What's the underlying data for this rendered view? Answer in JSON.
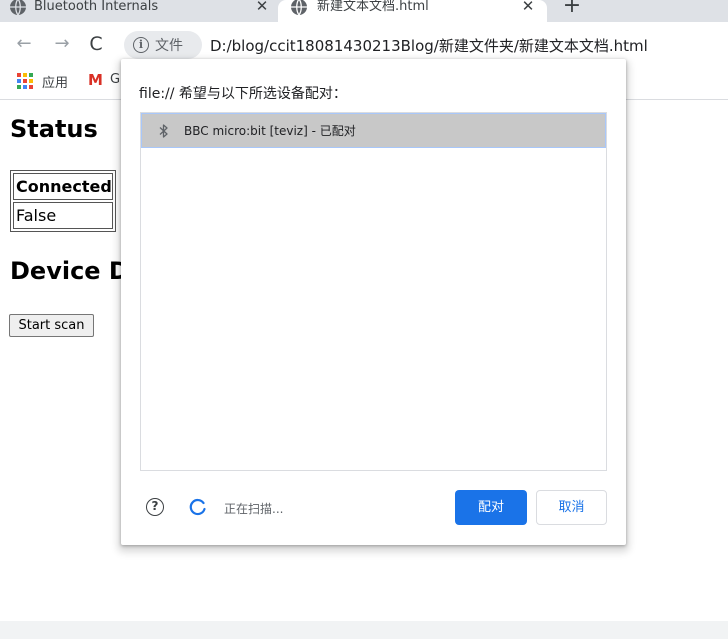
{
  "tabs": [
    {
      "title": "Bluetooth Internals",
      "close": "✕"
    },
    {
      "title": "新建文本文档.html",
      "close": "✕"
    }
  ],
  "new_tab": "+",
  "toolbar": {
    "back": "←",
    "forward": "→",
    "reload": "C",
    "chip_info": "i",
    "chip_label": "文件",
    "url": "D:/blog/ccit18081430213Blog/新建文件夹/新建文本文档.html"
  },
  "bookmarks": {
    "apps_label": "应用",
    "gmail_letter": "M",
    "gmail_label": "G"
  },
  "page": {
    "status_heading": "Status",
    "table": {
      "header": "Connected",
      "value": "False"
    },
    "device_heading": "Device Devices",
    "start_scan": "Start scan"
  },
  "dialog": {
    "title": "file:// 希望与以下所选设备配对：",
    "devices": [
      {
        "name": "BBC micro:bit [teviz] - 已配对",
        "selected": true
      }
    ],
    "help": "?",
    "status": "正在扫描...",
    "pair_label": "配对",
    "cancel_label": "取消"
  },
  "colors": {
    "accent": "#1a73e8",
    "tabstrip": "#dee1e6",
    "selected_row": "#c8c8c8"
  }
}
